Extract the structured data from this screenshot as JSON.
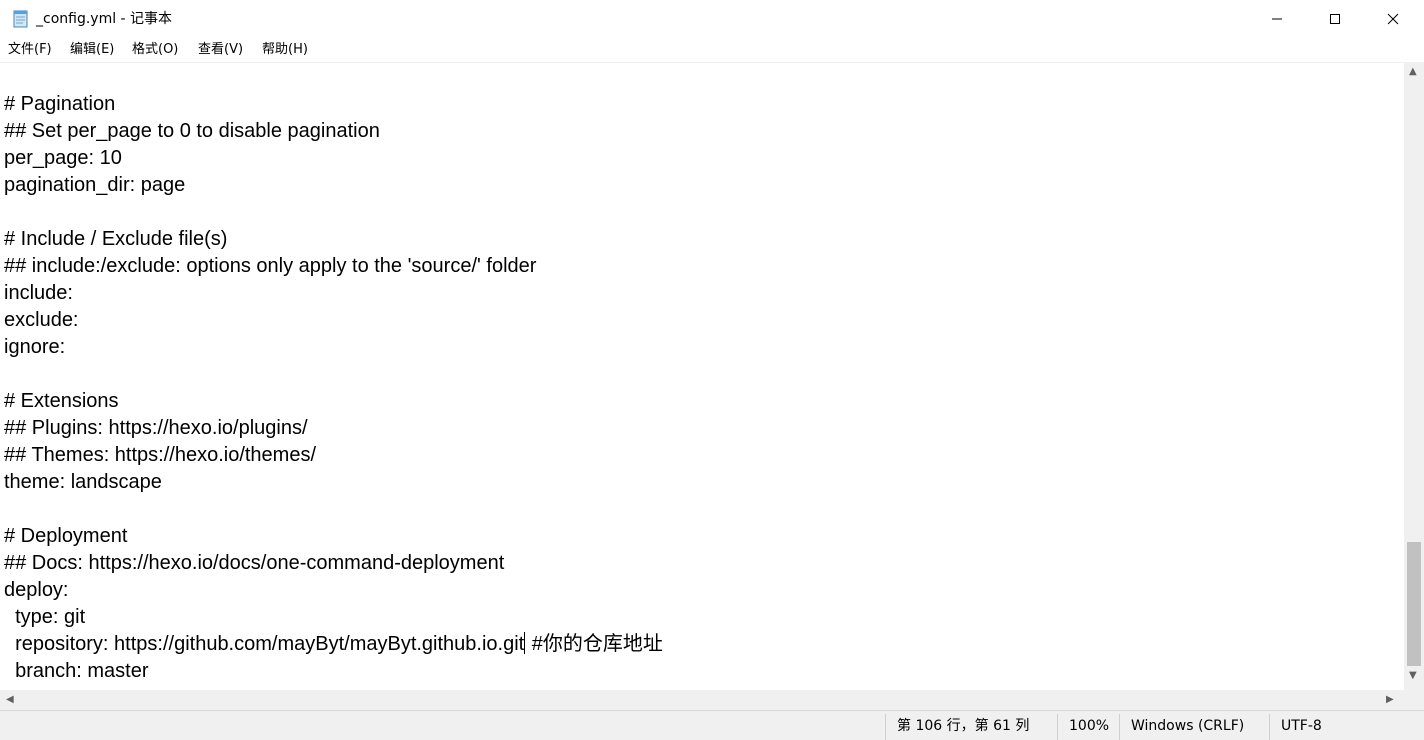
{
  "window": {
    "title": "_config.yml - 记事本",
    "app_icon": "notepad-icon",
    "controls": [
      "minimize-icon",
      "maximize-icon",
      "close-icon"
    ]
  },
  "menu": [
    "文件(F)",
    "编辑(E)",
    "格式(O)",
    "查看(V)",
    "帮助(H)"
  ],
  "editor": {
    "lines": [
      "# Pagination",
      "## Set per_page to 0 to disable pagination",
      "per_page: 10",
      "pagination_dir: page",
      "",
      "# Include / Exclude file(s)",
      "## include:/exclude: options only apply to the 'source/' folder",
      "include:",
      "exclude:",
      "ignore:",
      "",
      "# Extensions",
      "## Plugins: https://hexo.io/plugins/",
      "## Themes: https://hexo.io/themes/",
      "theme: landscape",
      "",
      "# Deployment",
      "## Docs: https://hexo.io/docs/one-command-deployment",
      "deploy:",
      "  type: git",
      "  repository: https://github.com/mayByt/mayByt.github.io.git",
      "  branch: master"
    ],
    "caret_line_after": " #你的仓库地址"
  },
  "scrollbar": {
    "vertical_up": "▲",
    "vertical_down": "▼",
    "horizontal_left": "◀",
    "horizontal_right": "▶"
  },
  "status": {
    "position": "第 106 行，第 61 列",
    "zoom": "100%",
    "line_ending": "Windows (CRLF)",
    "encoding": "UTF-8"
  }
}
